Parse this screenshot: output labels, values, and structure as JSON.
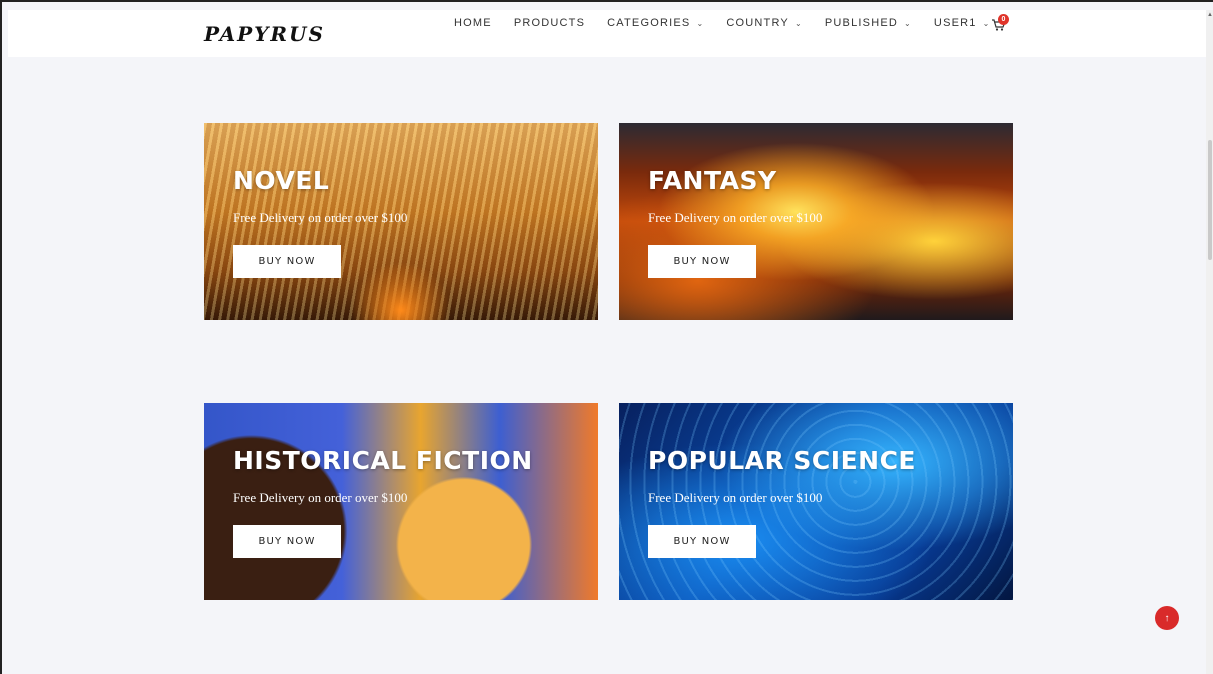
{
  "header": {
    "logo": "PAPYRUS",
    "nav": [
      {
        "label": "HOME",
        "dropdown": false
      },
      {
        "label": "PRODUCTS",
        "dropdown": false
      },
      {
        "label": "CATEGORIES",
        "dropdown": true
      },
      {
        "label": "COUNTRY",
        "dropdown": true
      },
      {
        "label": "PUBLISHED",
        "dropdown": true
      },
      {
        "label": "USER1",
        "dropdown": true
      }
    ],
    "chevron": "⌄",
    "cart_icon": "cart-icon",
    "cart_count": "0"
  },
  "banners": [
    {
      "title": "NOVEL",
      "subtitle": "Free Delivery on order over $100",
      "button": "BUY NOW"
    },
    {
      "title": "FANTASY",
      "subtitle": "Free Delivery on order over $100",
      "button": "BUY NOW"
    },
    {
      "title": "HISTORICAL FICTION",
      "subtitle": "Free Delivery on order over $100",
      "button": "BUY NOW"
    },
    {
      "title": "POPULAR SCIENCE",
      "subtitle": "Free Delivery on order over $100",
      "button": "BUY NOW"
    }
  ],
  "back_to_top": {
    "icon": "arrow-up-icon",
    "glyph": "↑"
  },
  "colors": {
    "accent": "#e0342a",
    "background": "#f4f5f9"
  }
}
